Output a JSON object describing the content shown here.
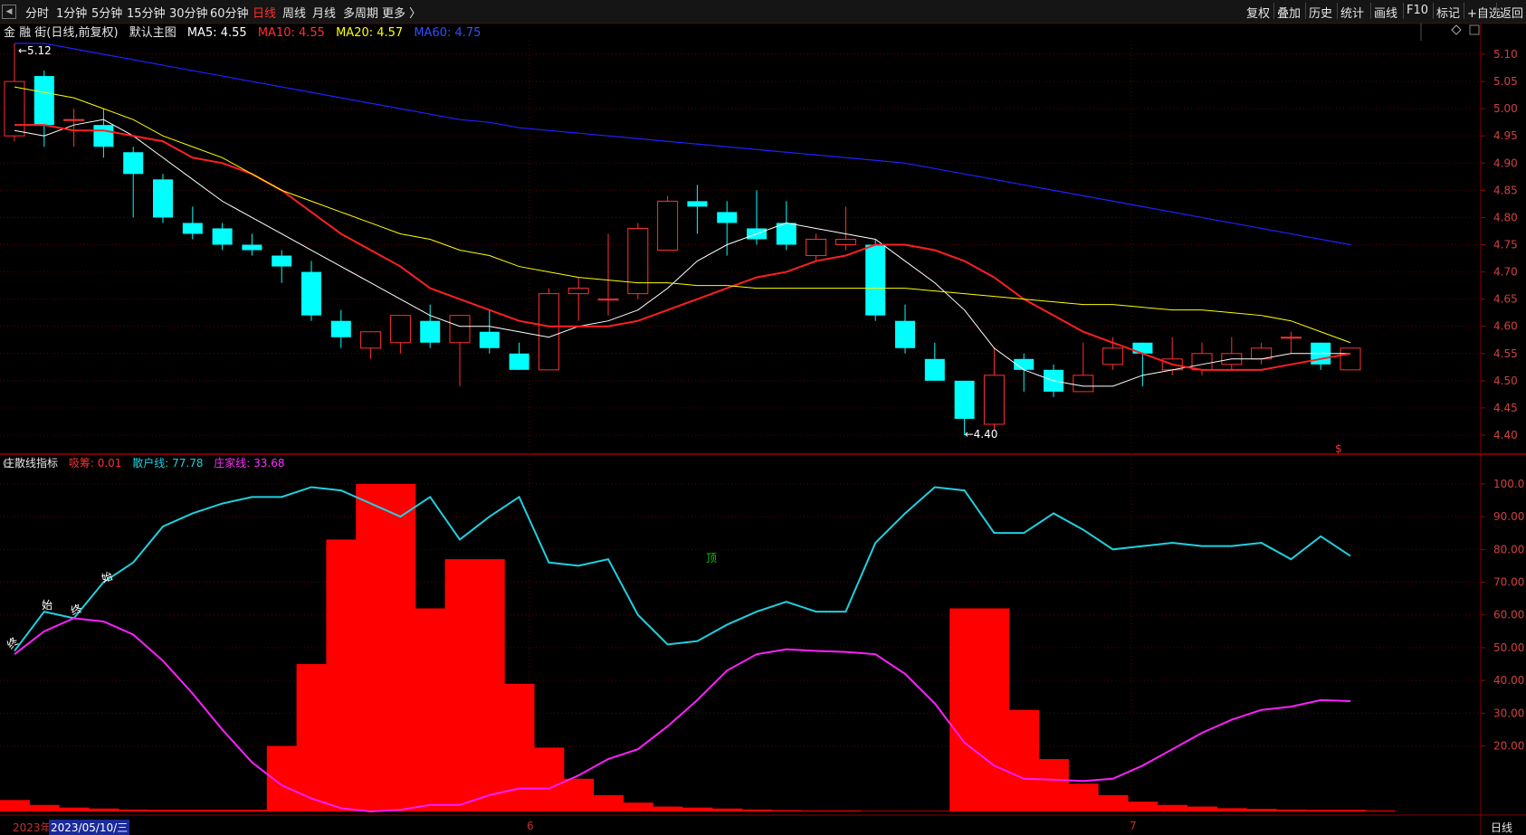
{
  "toolbar": {
    "items": [
      "分时",
      "1分钟",
      "5分钟",
      "15分钟",
      "30分钟",
      "60分钟",
      "日线",
      "周线",
      "月线",
      "多周期",
      "更多 〉"
    ],
    "active": "日线",
    "right_items": [
      "复权",
      "叠加",
      "历史",
      "统计",
      "画线",
      "F10",
      "标记",
      "+自选",
      "返回"
    ]
  },
  "main_header": {
    "stock": "金 融 街(日线,前复权)",
    "indicator": "默认主图",
    "ma5": "MA5: 4.55",
    "ma10": "MA10: 4.55",
    "ma20": "MA20: 4.57",
    "ma60": "MA60: 4.75"
  },
  "sub_header": {
    "name": "庄散线指标",
    "xichou": "吸筹: 0.01",
    "sanhu": "散户线: 77.78",
    "zhuangjia": "庄家线: 33.68"
  },
  "colors": {
    "up": "#ff3030",
    "down": "#00ffff",
    "ma5": "#ffffff",
    "ma10": "#ff2020",
    "ma20": "#ffff00",
    "ma60": "#2020ff",
    "sanhu": "#20d0e0",
    "zhuangjia": "#ff20ff",
    "xichou": "#ff0000"
  },
  "bottom": {
    "year": "2023年",
    "date": "2023/05/10/三",
    "month6": "6",
    "month7": "7",
    "period": "日线"
  },
  "chart_data": [
    {
      "type": "candlestick",
      "title": "",
      "ylim": [
        4.36,
        5.13
      ],
      "y_ticks": [
        "5.10",
        "5.05",
        "5.00",
        "4.95",
        "4.90",
        "4.85",
        "4.80",
        "4.75",
        "4.70",
        "4.65",
        "4.60",
        "4.55",
        "4.50",
        "4.45",
        "4.40"
      ],
      "y_tick_values": [
        5.1,
        5.05,
        5.0,
        4.95,
        4.9,
        4.85,
        4.8,
        4.75,
        4.7,
        4.65,
        4.6,
        4.55,
        4.5,
        4.45,
        4.4
      ],
      "annotations": {
        "high": "5.12",
        "low": "4.40",
        "marker": "$"
      },
      "candles": [
        {
          "o": 4.95,
          "h": 5.12,
          "l": 4.94,
          "c": 5.05
        },
        {
          "o": 5.06,
          "h": 5.07,
          "l": 4.93,
          "c": 4.97
        },
        {
          "o": 4.98,
          "h": 5.0,
          "l": 4.93,
          "c": 4.98
        },
        {
          "o": 4.97,
          "h": 5.0,
          "l": 4.91,
          "c": 4.93
        },
        {
          "o": 4.92,
          "h": 4.93,
          "l": 4.8,
          "c": 4.88
        },
        {
          "o": 4.87,
          "h": 4.88,
          "l": 4.79,
          "c": 4.8
        },
        {
          "o": 4.79,
          "h": 4.82,
          "l": 4.76,
          "c": 4.77
        },
        {
          "o": 4.78,
          "h": 4.79,
          "l": 4.74,
          "c": 4.75
        },
        {
          "o": 4.75,
          "h": 4.77,
          "l": 4.73,
          "c": 4.74
        },
        {
          "o": 4.73,
          "h": 4.74,
          "l": 4.68,
          "c": 4.71
        },
        {
          "o": 4.7,
          "h": 4.72,
          "l": 4.61,
          "c": 4.62
        },
        {
          "o": 4.61,
          "h": 4.63,
          "l": 4.56,
          "c": 4.58
        },
        {
          "o": 4.56,
          "h": 4.59,
          "l": 4.54,
          "c": 4.59
        },
        {
          "o": 4.57,
          "h": 4.62,
          "l": 4.55,
          "c": 4.62
        },
        {
          "o": 4.61,
          "h": 4.64,
          "l": 4.56,
          "c": 4.57
        },
        {
          "o": 4.57,
          "h": 4.62,
          "l": 4.49,
          "c": 4.62
        },
        {
          "o": 4.59,
          "h": 4.63,
          "l": 4.55,
          "c": 4.56
        },
        {
          "o": 4.55,
          "h": 4.57,
          "l": 4.52,
          "c": 4.52
        },
        {
          "o": 4.52,
          "h": 4.67,
          "l": 4.52,
          "c": 4.66
        },
        {
          "o": 4.66,
          "h": 4.69,
          "l": 4.61,
          "c": 4.67
        },
        {
          "o": 4.65,
          "h": 4.77,
          "l": 4.62,
          "c": 4.65
        },
        {
          "o": 4.66,
          "h": 4.79,
          "l": 4.65,
          "c": 4.78
        },
        {
          "o": 4.74,
          "h": 4.84,
          "l": 4.74,
          "c": 4.83
        },
        {
          "o": 4.83,
          "h": 4.86,
          "l": 4.77,
          "c": 4.82
        },
        {
          "o": 4.81,
          "h": 4.83,
          "l": 4.73,
          "c": 4.79
        },
        {
          "o": 4.78,
          "h": 4.85,
          "l": 4.75,
          "c": 4.76
        },
        {
          "o": 4.79,
          "h": 4.83,
          "l": 4.74,
          "c": 4.75
        },
        {
          "o": 4.73,
          "h": 4.77,
          "l": 4.72,
          "c": 4.76
        },
        {
          "o": 4.75,
          "h": 4.82,
          "l": 4.74,
          "c": 4.76
        },
        {
          "o": 4.75,
          "h": 4.76,
          "l": 4.61,
          "c": 4.62
        },
        {
          "o": 4.61,
          "h": 4.64,
          "l": 4.55,
          "c": 4.56
        },
        {
          "o": 4.54,
          "h": 4.57,
          "l": 4.5,
          "c": 4.5
        },
        {
          "o": 4.5,
          "h": 4.5,
          "l": 4.4,
          "c": 4.43
        },
        {
          "o": 4.42,
          "h": 4.56,
          "l": 4.41,
          "c": 4.51
        },
        {
          "o": 4.54,
          "h": 4.55,
          "l": 4.48,
          "c": 4.52
        },
        {
          "o": 4.52,
          "h": 4.53,
          "l": 4.47,
          "c": 4.48
        },
        {
          "o": 4.48,
          "h": 4.57,
          "l": 4.48,
          "c": 4.51
        },
        {
          "o": 4.53,
          "h": 4.58,
          "l": 4.52,
          "c": 4.56
        },
        {
          "o": 4.57,
          "h": 4.57,
          "l": 4.49,
          "c": 4.55
        },
        {
          "o": 4.52,
          "h": 4.58,
          "l": 4.51,
          "c": 4.54
        },
        {
          "o": 4.52,
          "h": 4.57,
          "l": 4.51,
          "c": 4.55
        },
        {
          "o": 4.53,
          "h": 4.58,
          "l": 4.52,
          "c": 4.55
        },
        {
          "o": 4.54,
          "h": 4.57,
          "l": 4.53,
          "c": 4.56
        },
        {
          "o": 4.58,
          "h": 4.59,
          "l": 4.55,
          "c": 4.58
        },
        {
          "o": 4.57,
          "h": 4.57,
          "l": 4.52,
          "c": 4.53
        },
        {
          "o": 4.52,
          "h": 4.56,
          "l": 4.52,
          "c": 4.56
        }
      ],
      "series": [
        {
          "name": "MA5",
          "values": [
            4.96,
            4.95,
            4.97,
            4.98,
            4.95,
            4.91,
            4.87,
            4.83,
            4.8,
            4.77,
            4.74,
            4.71,
            4.68,
            4.65,
            4.62,
            4.6,
            4.6,
            4.59,
            4.58,
            4.6,
            4.61,
            4.63,
            4.67,
            4.72,
            4.75,
            4.77,
            4.79,
            4.78,
            4.77,
            4.76,
            4.72,
            4.68,
            4.63,
            4.56,
            4.52,
            4.5,
            4.49,
            4.49,
            4.51,
            4.52,
            4.53,
            4.54,
            4.54,
            4.55,
            4.55,
            4.55
          ]
        },
        {
          "name": "MA10",
          "values": [
            4.97,
            4.97,
            4.96,
            4.96,
            4.95,
            4.94,
            4.91,
            4.9,
            4.88,
            4.85,
            4.81,
            4.77,
            4.74,
            4.71,
            4.67,
            4.65,
            4.63,
            4.61,
            4.6,
            4.6,
            4.6,
            4.61,
            4.63,
            4.65,
            4.67,
            4.69,
            4.7,
            4.72,
            4.73,
            4.75,
            4.75,
            4.74,
            4.72,
            4.69,
            4.65,
            4.62,
            4.59,
            4.57,
            4.55,
            4.53,
            4.52,
            4.52,
            4.52,
            4.53,
            4.54,
            4.55
          ]
        },
        {
          "name": "MA20",
          "values": [
            5.04,
            5.03,
            5.02,
            5.0,
            4.98,
            4.95,
            4.93,
            4.91,
            4.88,
            4.85,
            4.83,
            4.81,
            4.79,
            4.77,
            4.76,
            4.74,
            4.73,
            4.71,
            4.7,
            4.69,
            4.685,
            4.68,
            4.68,
            4.675,
            4.675,
            4.67,
            4.67,
            4.67,
            4.67,
            4.67,
            4.67,
            4.665,
            4.66,
            4.655,
            4.65,
            4.645,
            4.64,
            4.64,
            4.635,
            4.63,
            4.63,
            4.625,
            4.62,
            4.61,
            4.59,
            4.57
          ]
        },
        {
          "name": "MA60",
          "values": [
            5.12,
            5.12,
            5.11,
            5.1,
            5.09,
            5.08,
            5.07,
            5.06,
            5.05,
            5.04,
            5.03,
            5.02,
            5.01,
            5.0,
            4.99,
            4.98,
            4.975,
            4.965,
            4.96,
            4.955,
            4.95,
            4.945,
            4.94,
            4.935,
            4.93,
            4.925,
            4.92,
            4.915,
            4.91,
            4.905,
            4.9,
            4.89,
            4.88,
            4.87,
            4.86,
            4.85,
            4.84,
            4.83,
            4.82,
            4.81,
            4.8,
            4.79,
            4.78,
            4.77,
            4.76,
            4.75
          ]
        }
      ]
    },
    {
      "type": "bar",
      "title": "",
      "ylim": [
        0,
        103
      ],
      "y_ticks": [
        "100.0",
        "90.00",
        "80.00",
        "70.00",
        "60.00",
        "50.00",
        "40.00",
        "30.00",
        "20.00"
      ],
      "y_tick_values": [
        100,
        90,
        80,
        70,
        60,
        50,
        40,
        30,
        20
      ],
      "bars": [
        3.5,
        2,
        1.2,
        0.9,
        0.6,
        0.5,
        0.5,
        0.5,
        0.5,
        20,
        45,
        83,
        100,
        100,
        62,
        77,
        77,
        39,
        19.5,
        10,
        5,
        2.7,
        1.5,
        1.2,
        0.9,
        0.6,
        0.4,
        0.3,
        0.3,
        0.2,
        0.2,
        0.2,
        62,
        62,
        31,
        16,
        8.5,
        5,
        3,
        2,
        1.5,
        1,
        0.8,
        0.6,
        0.5,
        0.5,
        0.3
      ],
      "series": [
        {
          "name": "散户线",
          "values": [
            49,
            61,
            59,
            70,
            76,
            87,
            91,
            94,
            96,
            96,
            99,
            98,
            94,
            90,
            96,
            83,
            90,
            96,
            76,
            75,
            77,
            60,
            51,
            52,
            57,
            61,
            64,
            61,
            61,
            82,
            91,
            99,
            98,
            85,
            85,
            91,
            86,
            80,
            81,
            82,
            81,
            81,
            82,
            77,
            84,
            78
          ]
        },
        {
          "name": "庄家线",
          "values": [
            48,
            55,
            59,
            58,
            54,
            46,
            36,
            25,
            15,
            8,
            4,
            1,
            0,
            0.5,
            2,
            2,
            5,
            7,
            7,
            11,
            16,
            19,
            26,
            34,
            43,
            48,
            49.5,
            49,
            48.7,
            48,
            42,
            33,
            21,
            14,
            10,
            9.7,
            9.3,
            10,
            14,
            19,
            24,
            28,
            31,
            32,
            34,
            33.7
          ]
        }
      ],
      "annotations": [
        "终",
        "始",
        "终",
        "始",
        "顶"
      ]
    }
  ]
}
